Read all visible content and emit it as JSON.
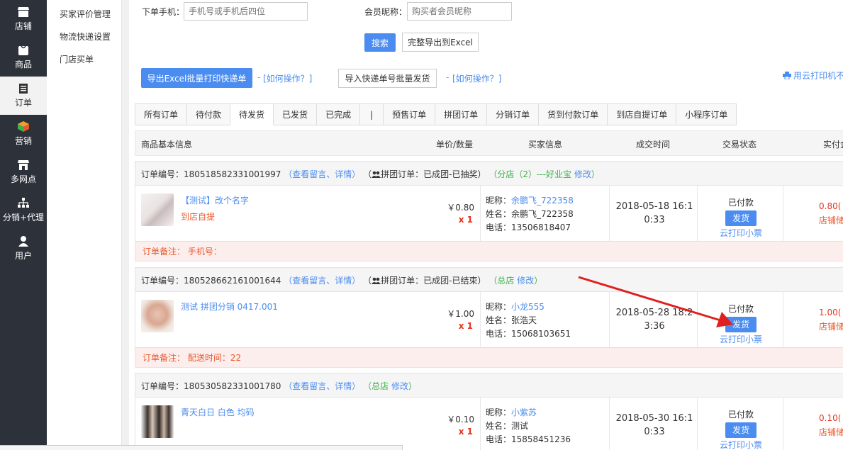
{
  "left_nav": [
    {
      "label": "店铺",
      "icon": "store-icon"
    },
    {
      "label": "商品",
      "icon": "goods-icon"
    },
    {
      "label": "订单",
      "icon": "order-icon",
      "active": true
    },
    {
      "label": "营销",
      "icon": "marketing-icon"
    },
    {
      "label": "多网点",
      "icon": "multi-store-icon"
    },
    {
      "label": "分销+代理",
      "icon": "distribution-icon"
    },
    {
      "label": "用户",
      "icon": "user-icon"
    }
  ],
  "sub_nav": [
    "买家评价管理",
    "物流快递设置",
    "门店买单"
  ],
  "filters": {
    "phone_label": "下单手机：",
    "phone_placeholder": "手机号或手机后四位",
    "nickname_label": "会员昵称：",
    "nickname_placeholder": "购买者会员昵称",
    "search_label": "搜索",
    "export_all_label": "完整导出到Excel"
  },
  "toolbar": {
    "export_print_label": "导出Excel批量打印快递单",
    "how_to_1": "[如何操作？]",
    "import_ship_label": "导入快递单号批量发货",
    "how_to_2": "[如何操作？]",
    "cloud_print_label": "用云打印机不"
  },
  "tabs": [
    "所有订单",
    "待付款",
    "待发货",
    "已发货",
    "已完成",
    "|",
    "预售订单",
    "拼团订单",
    "分销订单",
    "货到付款订单",
    "到店自提订单",
    "小程序订单"
  ],
  "table_header": {
    "product": "商品基本信息",
    "price_qty": "单价/数量",
    "buyer": "买家信息",
    "time": "成交时间",
    "status": "交易状态",
    "paid": "实付金"
  },
  "orders": [
    {
      "order_no": "订单编号：180518582331001997",
      "view_link": "查看留言、详情",
      "group_info": "拼团订单：已成团-已抽奖",
      "shop_prefix": "分店（2）---好业宝",
      "modify": "修改",
      "product_name": "【测试】改个名字",
      "pickup": "到店自提",
      "price": "￥0.80",
      "qty": "x 1",
      "buyer_nick_label": "昵称：",
      "buyer_nick": "余鹏飞_722358",
      "buyer_name": "姓名：余鹏飞_722358",
      "buyer_phone": "电话：13506818407",
      "time_line1": "2018-05-18 16:1",
      "time_line2": "0:33",
      "status": "已付款",
      "ship_label": "发货",
      "cloud_print": "云打印小票",
      "paid": "0.80(",
      "store_label": "店铺储",
      "remark": "订单备注： 手机号："
    },
    {
      "order_no": "订单编号：180528662161001644",
      "view_link": "查看留言、详情",
      "group_info": "拼团订单：已成团-已结束",
      "shop_prefix": "总店",
      "modify": "修改",
      "product_name": "测试 拼团分销 0417.001",
      "pickup": "",
      "price": "￥1.00",
      "qty": "x 1",
      "buyer_nick_label": "昵称：",
      "buyer_nick": "小龙555",
      "buyer_name": "姓名：张浩天",
      "buyer_phone": "电话：15068103651",
      "time_line1": "2018-05-28 18:2",
      "time_line2": "3:36",
      "status": "已付款",
      "ship_label": "发货",
      "cloud_print": "云打印小票",
      "paid": "1.00(",
      "store_label": "店铺储",
      "remark": "订单备注： 配送时间：22"
    },
    {
      "order_no": "订单编号：180530582331001780",
      "view_link": "查看留言、详情",
      "group_info": "",
      "shop_prefix": "总店",
      "modify": "修改",
      "product_name": "青天白日 白色 均码",
      "pickup": "",
      "price": "￥0.10",
      "qty": "x 1",
      "buyer_nick_label": "昵称：",
      "buyer_nick": "小紫苏",
      "buyer_name": "姓名：测试",
      "buyer_phone": "电话：15858451236",
      "time_line1": "2018-05-30 16:1",
      "time_line2": "0:33",
      "status": "已付款",
      "ship_label": "发货",
      "cloud_print": "云打印小票",
      "paid": "0.10(",
      "store_label": "店铺储",
      "remark": ""
    }
  ],
  "colors": {
    "nav_bg": "#2d3139",
    "accent": "#4b8cf0",
    "price_red": "#e8341c",
    "remark_bg": "#fdeeee",
    "arrow": "#e02020"
  }
}
